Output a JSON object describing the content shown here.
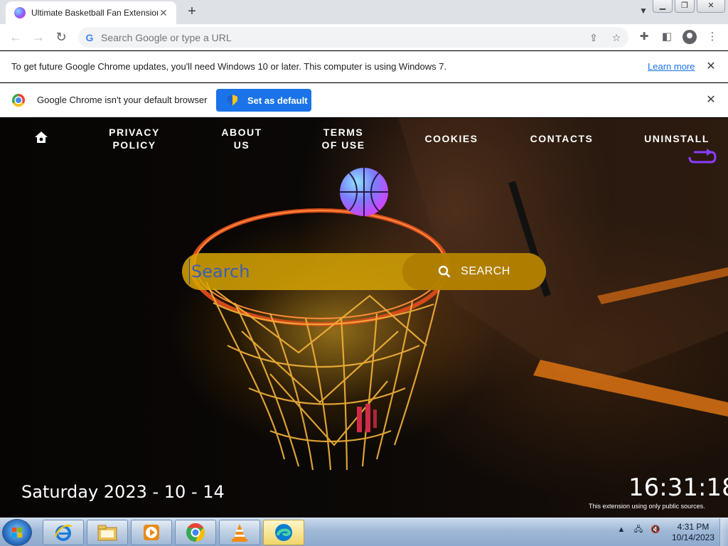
{
  "browser": {
    "tab": {
      "title": "Ultimate Basketball Fan Extension"
    },
    "omnibox": {
      "placeholder": "Search Google or type a URL"
    },
    "infobar_update": {
      "message": "To get future Google Chrome updates, you'll need Windows 10 or later. This computer is using Windows 7.",
      "link": "Learn more"
    },
    "infobar_default": {
      "message": "Google Chrome isn't your default browser",
      "button": "Set as default"
    }
  },
  "page": {
    "nav": {
      "items": [
        {
          "label": "PRIVACY\nPOLICY"
        },
        {
          "label": "ABOUT\nUS"
        },
        {
          "label": "TERMS\nOF USE"
        },
        {
          "label": "COOKIES"
        },
        {
          "label": "CONTACTS"
        },
        {
          "label": "UNINSTALL"
        }
      ]
    },
    "search": {
      "placeholder": "Search",
      "button": "SEARCH"
    },
    "date": "Saturday 2023 - 10 - 14",
    "time": "16:31:18",
    "notice": "This extension using only public sources."
  },
  "taskbar": {
    "apps": [
      "internet-explorer-icon",
      "file-explorer-icon",
      "media-player-icon",
      "chrome-icon",
      "vlc-icon",
      "edge-icon"
    ],
    "clock_time": "4:31 PM",
    "clock_date": "10/14/2023"
  }
}
